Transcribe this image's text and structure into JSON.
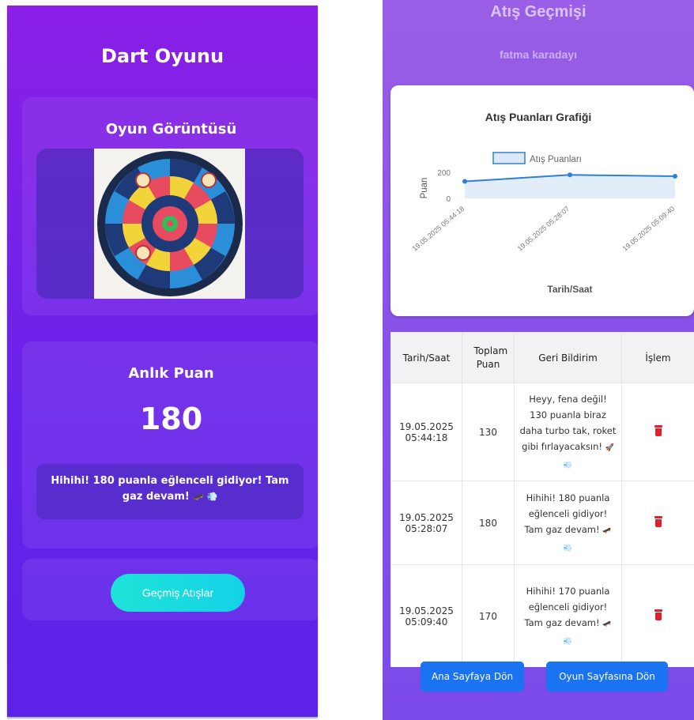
{
  "game": {
    "title": "Dart Oyunu",
    "view_heading": "Oyun Görüntüsü",
    "score_heading": "Anlık Puan",
    "current_score": "180",
    "feedback_text": "Hihihi! 180 puanla eğlenceli gidiyor! Tam gaz devam!",
    "feedback_emoji": "🛹 💨",
    "history_button": "Geçmiş Atışlar"
  },
  "history": {
    "title": "Atış Geçmişi",
    "username": "fatma karadayı",
    "table": {
      "headers": [
        "Tarih/Saat",
        "Toplam Puan",
        "Geri Bildirim",
        "İşlem"
      ],
      "rows": [
        {
          "date": "19.05.2025",
          "time": "05:44:18",
          "total": "130",
          "feedback": "Heyy, fena değil! 130 puanla biraz daha turbo tak, roket gibi fırlayacaksın!",
          "emoji": "🚀 💨"
        },
        {
          "date": "19.05.2025",
          "time": "05:28:07",
          "total": "180",
          "feedback": "Hihihi! 180 puanla eğlenceli gidiyor! Tam gaz devam!",
          "emoji": "🛹 💨"
        },
        {
          "date": "19.05.2025",
          "time": "05:09:40",
          "total": "170",
          "feedback": "Hihihi! 170 puanla eğlenceli gidiyor! Tam gaz devam!",
          "emoji": "🛹 💨"
        }
      ]
    },
    "buttons": {
      "home": "Ana Sayfaya Dön",
      "game": "Oyun Sayfasına Dön"
    },
    "icons": {
      "delete": "trash-icon"
    }
  },
  "chart_data": {
    "type": "line",
    "title": "Atış Puanları Grafiği",
    "xlabel": "Tarih/Saat",
    "ylabel": "Puan",
    "categories": [
      "19.05.2025 05:44:18",
      "19.05.2025 05:28:07",
      "19.05.2025 05:09:40"
    ],
    "series": [
      {
        "name": "Atış Puanları",
        "values": [
          130,
          180,
          170
        ]
      }
    ],
    "yticks": [
      0,
      200
    ],
    "ylim": [
      0,
      200
    ],
    "legend": "top",
    "grid": false,
    "color": "#2f7fd8"
  },
  "colors": {
    "left_gradient_top": "#8a1fe6",
    "left_gradient_bottom": "#5b22e8",
    "accent_cyan": "#1fe3d9",
    "button_blue": "#1a73f0",
    "delete_red": "#e0202a"
  }
}
